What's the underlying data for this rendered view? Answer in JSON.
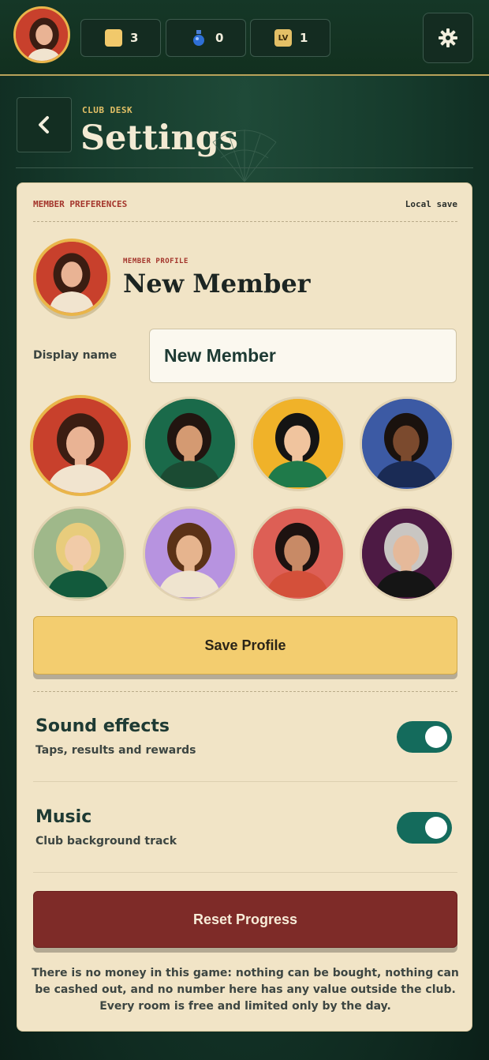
{
  "topbar": {
    "stats": [
      {
        "icon": "coin-icon",
        "value": "3"
      },
      {
        "icon": "potion-icon",
        "value": "0"
      },
      {
        "icon": "level-icon",
        "icon_text": "LV",
        "value": "1"
      }
    ]
  },
  "header": {
    "eyebrow": "CLUB DESK",
    "title": "Settings"
  },
  "panel": {
    "head_left": "MEMBER PREFERENCES",
    "head_right": "Local save",
    "profile_eyebrow": "MEMBER PROFILE",
    "profile_name": "New Member",
    "display_name_label": "Display name",
    "display_name_value": "New Member",
    "save_label": "Save Profile",
    "settings": [
      {
        "title": "Sound effects",
        "subtitle": "Taps, results and rewards",
        "enabled": true
      },
      {
        "title": "Music",
        "subtitle": "Club background track",
        "enabled": true
      }
    ],
    "reset_label": "Reset Progress",
    "disclaimer": "There is no money in this game: nothing can be bought, nothing can be cashed out, and no number here has any value outside the club. Every room is free and limited only by the day."
  },
  "avatars": [
    {
      "name": "avatar-woman-red",
      "bg": "#c8402c",
      "skin": "#e9b394",
      "hair": "#3b1d12",
      "shirt": "#f1e4cf",
      "selected": true
    },
    {
      "name": "avatar-man-green",
      "bg": "#1a6a4a",
      "skin": "#d49a72",
      "hair": "#221510",
      "shirt": "#1b4b33",
      "selected": false
    },
    {
      "name": "avatar-woman-yellow",
      "bg": "#f0b229",
      "skin": "#f0c49e",
      "hair": "#141414",
      "shirt": "#1f7a4a",
      "selected": false
    },
    {
      "name": "avatar-man-blue",
      "bg": "#3c5aa4",
      "skin": "#7b4a2e",
      "hair": "#1a120e",
      "shirt": "#1a2b55",
      "selected": false
    },
    {
      "name": "avatar-woman-sage",
      "bg": "#9fb88a",
      "skin": "#f1cba8",
      "hair": "#e8cc7c",
      "shirt": "#125a3c",
      "selected": false
    },
    {
      "name": "avatar-man-lavender",
      "bg": "#b793e0",
      "skin": "#e6b48e",
      "hair": "#5b3217",
      "shirt": "#efe4cf",
      "selected": false
    },
    {
      "name": "avatar-woman-coral",
      "bg": "#dd5f55",
      "skin": "#c88a66",
      "hair": "#1d1210",
      "shirt": "#d4503a",
      "selected": false
    },
    {
      "name": "avatar-man-purple",
      "bg": "#4d1a44",
      "skin": "#e5b99a",
      "hair": "#c9c6c2",
      "shirt": "#151515",
      "selected": false
    }
  ]
}
